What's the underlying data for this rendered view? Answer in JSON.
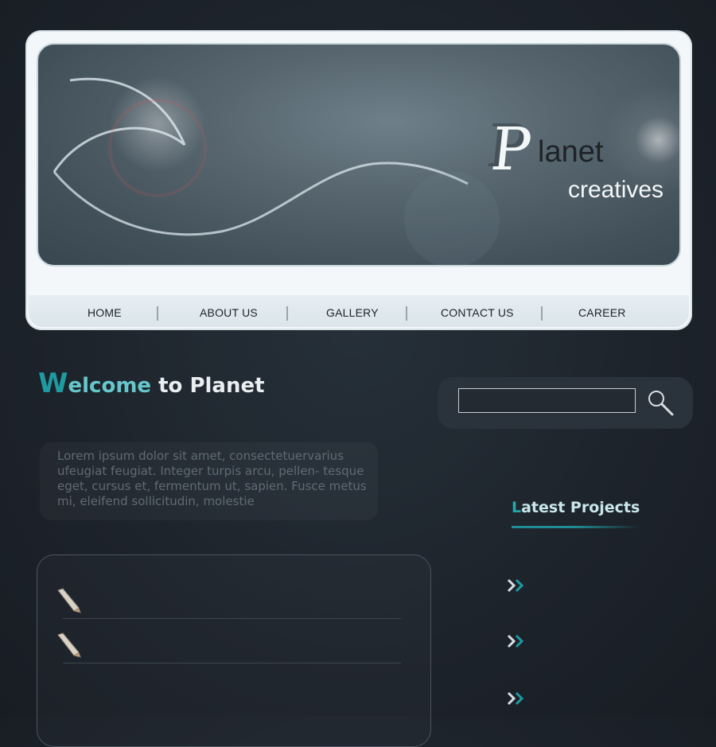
{
  "brand": {
    "logo_letter": "P",
    "logo_word": "lanet",
    "logo_sub": "creatives"
  },
  "nav": {
    "items": [
      {
        "label": "HOME"
      },
      {
        "label": "ABOUT US"
      },
      {
        "label": "GALLERY"
      },
      {
        "label": "CONTACT US"
      },
      {
        "label": "CAREER"
      }
    ]
  },
  "welcome": {
    "first_letter": "W",
    "highlight": "elcome",
    "rest": " to Planet"
  },
  "intro_text": "Lorem ipsum dolor sit amet, consectetuervarius ufeugiat feugiat. Integer turpis arcu, pellen- tesque eget, cursus et, fermentum ut, sapien. Fusce metus mi, eleifend sollicitudin, molestie",
  "search": {
    "value": "",
    "placeholder": ""
  },
  "latest_projects": {
    "first_letter": "L",
    "rest": "atest Projects"
  },
  "icons": {
    "search": "search-icon",
    "pencil": "pencil-icon",
    "arrow": "double-chevron-right-icon"
  },
  "colors": {
    "accent": "#1f9aa0",
    "accent_light": "#66c7cb",
    "background": "#1d232b",
    "frame": "#f3f7f9"
  }
}
